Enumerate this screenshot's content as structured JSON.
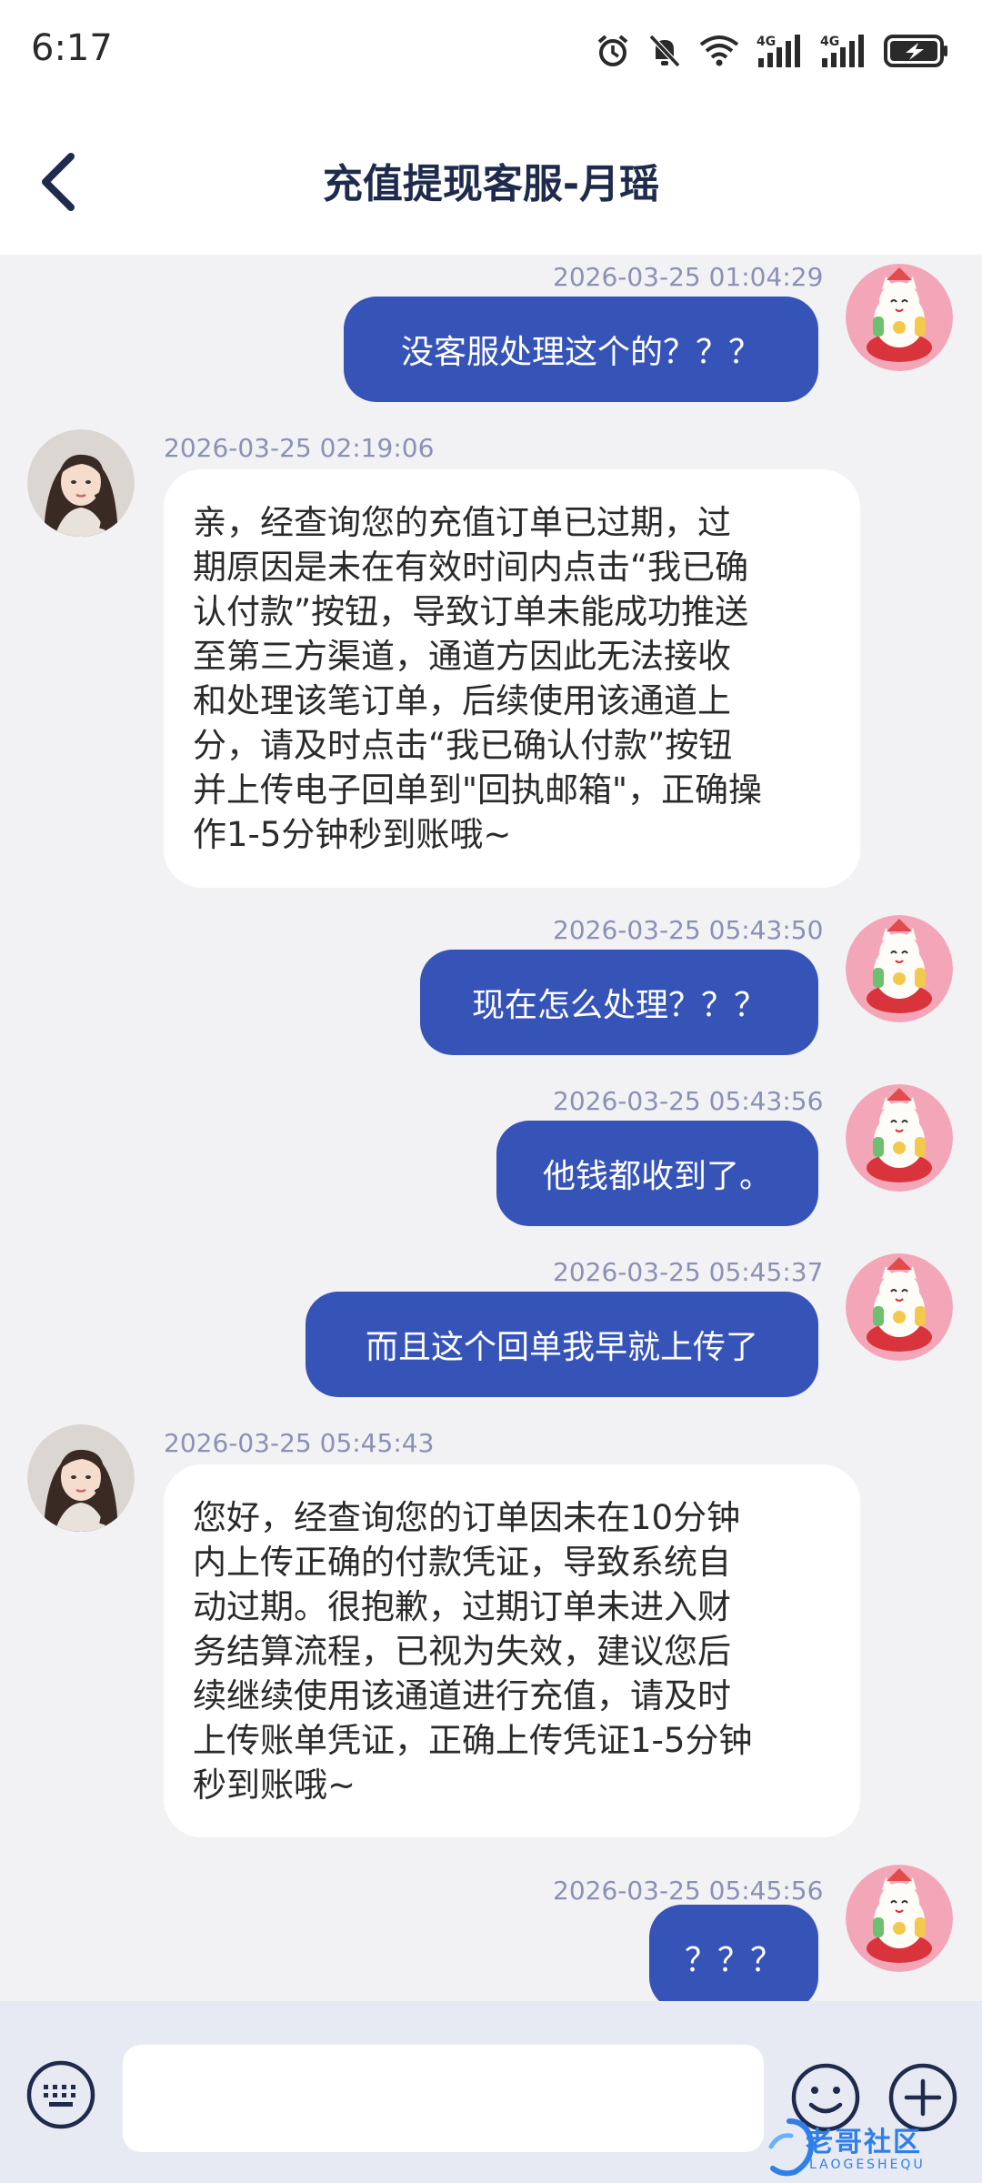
{
  "status_bar": {
    "time": "6:17",
    "network_1": "4G",
    "network_2": "4G",
    "icons": [
      "alarm-icon",
      "mute-icon",
      "wifi-icon",
      "signal-4g-icon",
      "signal-4g-icon",
      "battery-charging-icon"
    ]
  },
  "header": {
    "title": "充值提现客服-月瑶",
    "back_icon": "chevron-left-icon"
  },
  "colors": {
    "accent": "#3653b8",
    "title": "#1f2b4d",
    "timestamp": "#8a91b5",
    "background": "#f2f2f5",
    "bottom_bar": "#e7eaf2"
  },
  "messages": [
    {
      "direction": "outgoing",
      "time": "2026-03-25 01:04:29",
      "text": "没客服处理这个的？？？"
    },
    {
      "direction": "incoming",
      "time": "2026-03-25 02:19:06",
      "lines": [
        "亲，经查询您的充值订单已过期，过",
        "期原因是未在有效时间内点击“我已确",
        "认付款”按钮，导致订单未能成功推送",
        "至第三方渠道，通道方因此无法接收",
        "和处理该笔订单，后续使用该通道上",
        "分，请及时点击“我已确认付款”按钮",
        "并上传电子回单到\"回执邮箱\"，正确操",
        "作1-5分钟秒到账哦~"
      ]
    },
    {
      "direction": "outgoing",
      "time": "2026-03-25 05:43:50",
      "text": "现在怎么处理？？？"
    },
    {
      "direction": "outgoing",
      "time": "2026-03-25 05:43:56",
      "text": "他钱都收到了。"
    },
    {
      "direction": "outgoing",
      "time": "2026-03-25 05:45:37",
      "text": "而且这个回单我早就上传了"
    },
    {
      "direction": "incoming",
      "time": "2026-03-25 05:45:43",
      "lines": [
        "您好，经查询您的订单因未在10分钟",
        "内上传正确的付款凭证，导致系统自",
        "动过期。很抱歉，过期订单未进入财",
        "务结算流程，已视为失效，建议您后",
        "续继续使用该通道进行充值，请及时",
        "上传账单凭证，正确上传凭证1-5分钟",
        "秒到账哦~"
      ]
    },
    {
      "direction": "outgoing",
      "time": "2026-03-25 05:45:56",
      "text": "？？？"
    }
  ],
  "input_bar": {
    "value": "",
    "placeholder": "",
    "keyboard_icon": "keyboard-icon",
    "emoji_icon": "emoji-icon",
    "plus_icon": "plus-icon"
  },
  "watermark": {
    "text": "老哥社区",
    "subtext": "LAOGESHEQU"
  }
}
